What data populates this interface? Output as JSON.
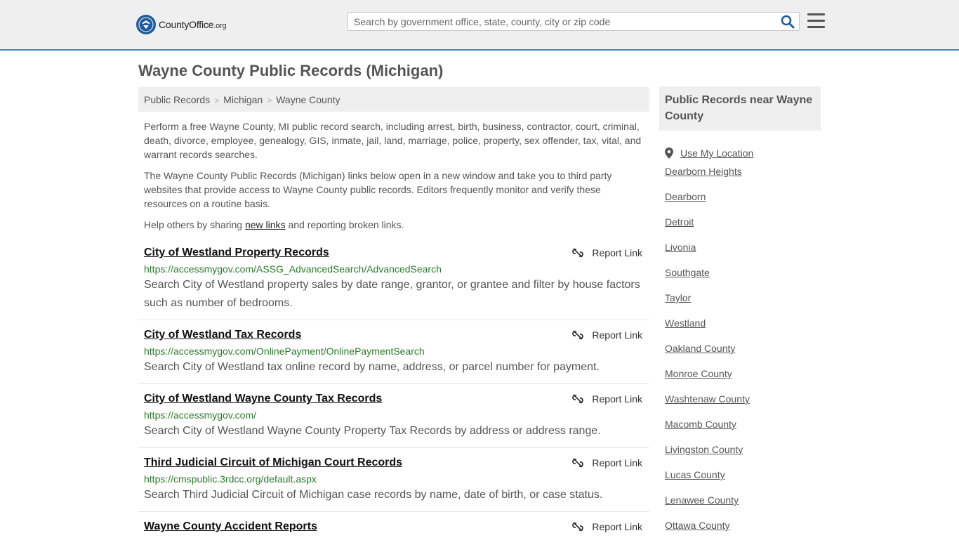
{
  "header": {
    "logo_text": "CountyOffice",
    "logo_suffix": ".org",
    "search_placeholder": "Search by government office, state, county, city or zip code"
  },
  "page": {
    "title": "Wayne County Public Records (Michigan)"
  },
  "breadcrumb": [
    "Public Records",
    "Michigan",
    "Wayne County"
  ],
  "intro": {
    "p1": "Perform a free Wayne County, MI public record search, including arrest, birth, business, contractor, court, criminal, death, divorce, employee, genealogy, GIS, inmate, jail, land, marriage, police, property, sex offender, tax, vital, and warrant records searches.",
    "p2": "The Wayne County Public Records (Michigan) links below open in a new window and take you to third party websites that provide access to Wayne County public records. Editors frequently monitor and verify these resources on a routine basis.",
    "p3_before": "Help others by sharing ",
    "p3_link": "new links",
    "p3_after": " and reporting broken links."
  },
  "report_label": "Report Link",
  "records": [
    {
      "title": "City of Westland Property Records",
      "url": "https://accessmygov.com/ASSG_AdvancedSearch/AdvancedSearch",
      "desc": "Search City of Westland property sales by date range, grantor, or grantee and filter by house factors such as number of bedrooms."
    },
    {
      "title": "City of Westland Tax Records",
      "url": "https://accessmygov.com/OnlinePayment/OnlinePaymentSearch",
      "desc": "Search City of Westland tax online record by name, address, or parcel number for payment."
    },
    {
      "title": "City of Westland Wayne County Tax Records",
      "url": "https://accessmygov.com/",
      "desc": "Search City of Westland Wayne County Property Tax Records by address or address range."
    },
    {
      "title": "Third Judicial Circuit of Michigan Court Records",
      "url": "https://cmspublic.3rdcc.org/default.aspx",
      "desc": "Search Third Judicial Circuit of Michigan case records by name, date of birth, or case status."
    },
    {
      "title": "Wayne County Accident Reports",
      "url": "",
      "desc": ""
    }
  ],
  "sidebar": {
    "heading": "Public Records near Wayne County",
    "location_label": "Use My Location",
    "items": [
      "Dearborn Heights",
      "Dearborn",
      "Detroit",
      "Livonia",
      "Southgate",
      "Taylor",
      "Westland",
      "Oakland County",
      "Monroe County",
      "Washtenaw County",
      "Macomb County",
      "Livingston County",
      "Lucas County",
      "Lenawee County",
      "Ottawa County"
    ]
  },
  "colors": {
    "accent": "#4a86c5",
    "brand": "#1f5c9e",
    "url_green": "#2a7d2a"
  }
}
